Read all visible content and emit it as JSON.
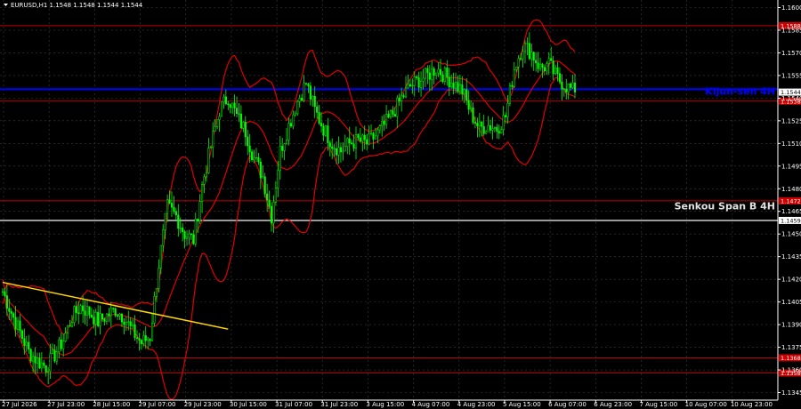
{
  "window": {
    "title": "EURUSD,H1  1.1548 1.1548 1.1544 1.1544"
  },
  "colors": {
    "background": "#000000",
    "grid": "#3c3c3c",
    "axis": "#ffffff",
    "candle_bull": "#00ff00",
    "candle_bear": "#00ff00",
    "bollinger": "#e00000",
    "support_resistance": "#c00000",
    "kijun": "#0000ff",
    "senkou": "#e0e0e0",
    "trendline": "#ffd700",
    "price_label_bg": "#cc0000",
    "current_price_bg": "#ffffff"
  },
  "chart_data": {
    "type": "candlestick",
    "symbol": "EURUSD",
    "timeframe": "H1",
    "ylim": [
      1.134,
      1.1605
    ],
    "y_ticks": [
      "1.1600",
      "1.1585",
      "1.1570",
      "1.1555",
      "1.1540",
      "1.1525",
      "1.1510",
      "1.1495",
      "1.1480",
      "1.1465",
      "1.1450",
      "1.1435",
      "1.1420",
      "1.1405",
      "1.1390",
      "1.1375",
      "1.1360",
      "1.1345"
    ],
    "x_ticks": [
      "27 Jul 2026",
      "27 Jul 23:00",
      "28 Jul 15:00",
      "29 Jul 07:00",
      "29 Jul 23:00",
      "30 Jul 15:00",
      "31 Jul 07:00",
      "31 Jul 23:00",
      "3 Aug 15:00",
      "4 Aug 07:00",
      "4 Aug 23:00",
      "5 Aug 15:00",
      "6 Aug 07:00",
      "6 Aug 23:00",
      "7 Aug 15:00",
      "10 Aug 07:00",
      "10 Aug 23:00"
    ],
    "series_shape": [
      1.1412,
      1.1398,
      1.1385,
      1.1372,
      1.1366,
      1.1362,
      1.137,
      1.138,
      1.1395,
      1.1402,
      1.1398,
      1.1392,
      1.1396,
      1.14,
      1.1395,
      1.1385,
      1.1378,
      1.1382,
      1.143,
      1.1468,
      1.1462,
      1.145,
      1.1446,
      1.1482,
      1.1508,
      1.1532,
      1.1541,
      1.1528,
      1.1518,
      1.15,
      1.1488,
      1.1462,
      1.1505,
      1.1522,
      1.1538,
      1.155,
      1.1532,
      1.152,
      1.151,
      1.1505,
      1.151,
      1.1512,
      1.151,
      1.1515,
      1.1522,
      1.153,
      1.154,
      1.1548,
      1.1552,
      1.1555,
      1.156,
      1.1555,
      1.155,
      1.1545,
      1.153,
      1.152,
      1.1522,
      1.152,
      1.1528,
      1.156,
      1.1575,
      1.157,
      1.156,
      1.1562,
      1.1553,
      1.1548,
      1.1544
    ],
    "levels": [
      {
        "price": 1.1588,
        "label": "1.1588",
        "kind": "resistance"
      },
      {
        "price": 1.1546,
        "label": "",
        "kind": "kijun"
      },
      {
        "price": 1.1538,
        "label": "1.1538",
        "kind": "resistance"
      },
      {
        "price": 1.1472,
        "label": "1.1472",
        "kind": "resistance"
      },
      {
        "price": 1.1459,
        "label": "1.1459",
        "kind": "senkou"
      },
      {
        "price": 1.1368,
        "label": "1.1368",
        "kind": "support"
      },
      {
        "price": 1.1358,
        "label": "1.1358",
        "kind": "support"
      }
    ],
    "current_price": {
      "price": 1.1544,
      "label": "1.1544"
    },
    "annotations": [
      {
        "text": "Kijun-sen 4H",
        "price": 1.1541,
        "color": "#0000ff"
      },
      {
        "text": "Senkou Span B 4H",
        "price": 1.1465,
        "color": "#e0e0e0"
      }
    ],
    "trendline": {
      "from": {
        "index": 0,
        "price": 1.1418
      },
      "to": {
        "index": 26,
        "price": 1.1387
      }
    }
  }
}
